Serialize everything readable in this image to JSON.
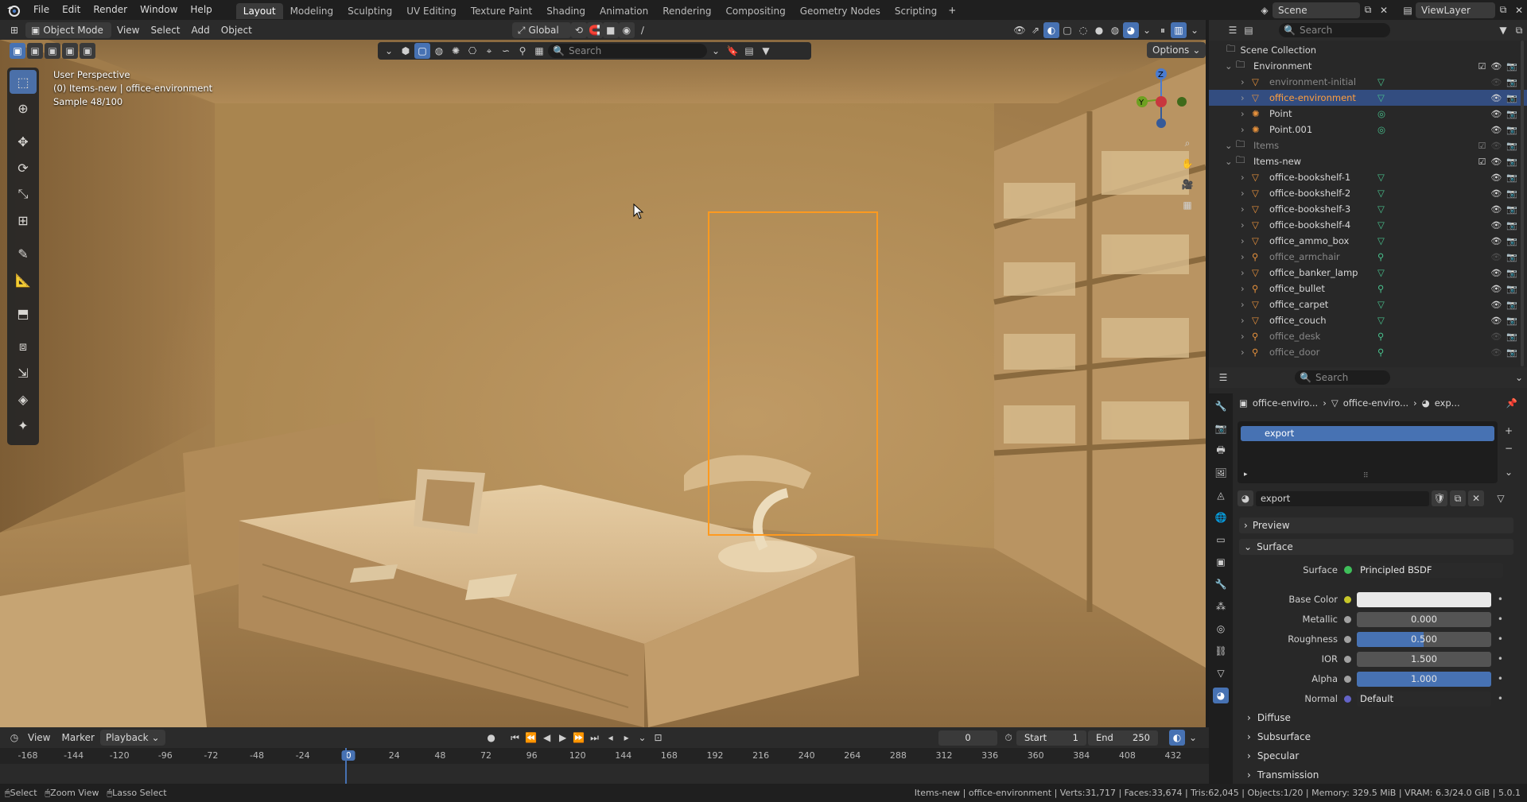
{
  "app": {
    "logo": "blender-logo-icon"
  },
  "menu": [
    "File",
    "Edit",
    "Render",
    "Window",
    "Help"
  ],
  "workspaces": [
    "Layout",
    "Modeling",
    "Sculpting",
    "UV Editing",
    "Texture Paint",
    "Shading",
    "Animation",
    "Rendering",
    "Compositing",
    "Geometry Nodes",
    "Scripting"
  ],
  "active_workspace": "Layout",
  "scene": {
    "name": "Scene",
    "view_layer": "ViewLayer"
  },
  "viewport_header": {
    "mode": "Object Mode",
    "menus": [
      "View",
      "Select",
      "Add",
      "Object"
    ],
    "transform": "Global",
    "search_placeholder": "Search",
    "options": "Options"
  },
  "viewport_info": {
    "line1": "User Perspective",
    "line2": "(0) Items-new | office-environment",
    "line3": "Sample 48/100"
  },
  "outliner": {
    "search_placeholder": "Search",
    "root": "Scene Collection",
    "rows": [
      {
        "label": "Environment",
        "type": "collection",
        "indent": 1,
        "dim": false
      },
      {
        "label": "environment-initial",
        "type": "object",
        "indent": 2,
        "dim": true
      },
      {
        "label": "office-environment",
        "type": "object",
        "indent": 2,
        "dim": false,
        "selected": true
      },
      {
        "label": "Point",
        "type": "light",
        "indent": 2,
        "dim": false
      },
      {
        "label": "Point.001",
        "type": "light",
        "indent": 2,
        "dim": false
      },
      {
        "label": "Items",
        "type": "collection",
        "indent": 1,
        "dim": true
      },
      {
        "label": "Items-new",
        "type": "collection",
        "indent": 1,
        "dim": false
      },
      {
        "label": "office-bookshelf-1",
        "type": "object",
        "indent": 2,
        "dim": false
      },
      {
        "label": "office-bookshelf-2",
        "type": "object",
        "indent": 2,
        "dim": false
      },
      {
        "label": "office-bookshelf-3",
        "type": "object",
        "indent": 2,
        "dim": false
      },
      {
        "label": "office-bookshelf-4",
        "type": "object",
        "indent": 2,
        "dim": false
      },
      {
        "label": "office_ammo_box",
        "type": "object",
        "indent": 2,
        "dim": false
      },
      {
        "label": "office_armchair",
        "type": "armature",
        "indent": 2,
        "dim": true
      },
      {
        "label": "office_banker_lamp",
        "type": "object",
        "indent": 2,
        "dim": false
      },
      {
        "label": "office_bullet",
        "type": "armature",
        "indent": 2,
        "dim": false
      },
      {
        "label": "office_carpet",
        "type": "object",
        "indent": 2,
        "dim": false
      },
      {
        "label": "office_couch",
        "type": "object",
        "indent": 2,
        "dim": false
      },
      {
        "label": "office_desk",
        "type": "armature",
        "indent": 2,
        "dim": true
      },
      {
        "label": "office_door",
        "type": "armature",
        "indent": 2,
        "dim": true
      }
    ]
  },
  "properties": {
    "search_placeholder": "Search",
    "breadcrumb": [
      "office-enviro...",
      "office-enviro...",
      "exp..."
    ],
    "material_slot": "export",
    "material_name": "export",
    "sections": {
      "preview": "Preview",
      "surface": "Surface",
      "diffuse": "Diffuse",
      "subsurface": "Subsurface",
      "specular": "Specular",
      "transmission": "Transmission"
    },
    "surface_shader_label": "Surface",
    "surface_shader": "Principled BSDF",
    "fields": [
      {
        "label": "Base Color",
        "value": "",
        "kind": "color"
      },
      {
        "label": "Metallic",
        "value": "0.000",
        "fill": 0.0
      },
      {
        "label": "Roughness",
        "value": "0.500",
        "fill": 0.5
      },
      {
        "label": "IOR",
        "value": "1.500",
        "fill": 0.0
      },
      {
        "label": "Alpha",
        "value": "1.000",
        "fill": 1.0
      },
      {
        "label": "Normal",
        "value": "Default",
        "kind": "link"
      }
    ]
  },
  "timeline": {
    "menus": [
      "View",
      "Marker",
      "Playback"
    ],
    "current_frame": "0",
    "start_label": "Start",
    "start": "1",
    "end_label": "End",
    "end": "250",
    "ticks": [
      "-168",
      "-144",
      "-120",
      "-96",
      "-72",
      "-48",
      "-24",
      "0",
      "24",
      "48",
      "72",
      "96",
      "120",
      "144",
      "168",
      "192",
      "216",
      "240",
      "264",
      "288",
      "312",
      "336",
      "360",
      "384",
      "408",
      "432"
    ]
  },
  "status": {
    "left": [
      "Select",
      "Zoom View",
      "Lasso Select"
    ],
    "right": "Items-new | office-environment | Verts:31,717 | Faces:33,674 | Tris:62,045 | Objects:1/20 | Memory: 329.5 MiB | VRAM: 6.3/24.0 GiB | 5.0.1"
  },
  "colors": {
    "accent": "#4772b3",
    "selection_outline": "#ff9a1f",
    "header": "#2b2b2b",
    "panel": "#282828"
  }
}
